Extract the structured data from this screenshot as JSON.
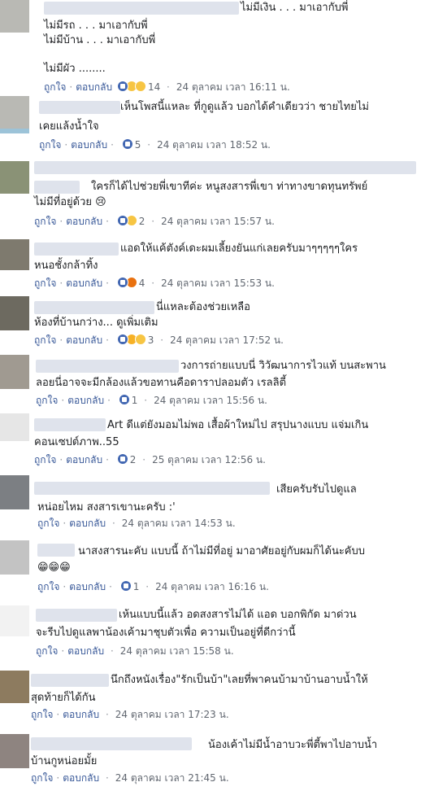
{
  "actions": {
    "like": "ถูกใจ",
    "reply": "ตอบกลับ",
    "dot": "·"
  },
  "comments": [
    {
      "lines": [
        "ไม่มีเงิน . . . มาเอากับพี่",
        "ไม่มีรถ . . . มาเอากับพี่",
        "ไม่มีบ้าน . . . มาเอากับพี่",
        "ไม่มีผัว ........"
      ],
      "reactions": [
        "like-icon",
        "haha-icon",
        "haha-icon"
      ],
      "count": "14",
      "time": "24 ตุลาคม เวลา 16:11 น."
    },
    {
      "lines": [
        "เห็นโพสนี้แหละ ที่กูดูแล้ว บอกได้คำเดียวว่า ชายไทยไม่",
        "เคยแล้งน้ำใจ"
      ],
      "reactions": [
        "like-icon"
      ],
      "count": "5",
      "time": "24 ตุลาคม เวลา 18:52 น."
    },
    {
      "lines": [
        "ใครก็ได้ไปช่วยพี่เขาทีค่ะ หนูสงสารพี่เขา ท่าทางขาดทุนทรัพย์",
        "ไม่มีที่อยู่ด้วย 😢"
      ],
      "reactions": [
        "like-icon",
        "haha-icon"
      ],
      "count": "2",
      "time": "24 ตุลาคม เวลา 15:57 น."
    },
    {
      "lines": [
        "แอดให้แค้ตังค์เดะผมเลี้ยงยันแก่เลยครับมาๆๆๆๆๆใคร",
        "หนอชั้งกล้าทิ้ง"
      ],
      "reactions": [
        "like-icon",
        "angry-icon"
      ],
      "count": "4",
      "time": "24 ตุลาคม เวลา 15:53 น."
    },
    {
      "lines": [
        "นี่แหละต้องช่วยเหลือ",
        "ห้องที่บ้านกว่าง... ดูเพิ่มเติม"
      ],
      "reactions": [
        "like-icon",
        "wow-icon",
        "haha-icon"
      ],
      "count": "3",
      "time": "24 ตุลาคม เวลา 17:52 น."
    },
    {
      "lines": [
        "วงการถ่ายแบบนี่ วิวัฒนาการไวแท้ บนสะพาน",
        "ลอยนี่อาจจะมีกล้องแล้วขอทานคือดาราปลอมตัว เรลลิตี้"
      ],
      "reactions": [
        "like-icon"
      ],
      "count": "1",
      "time": "24 ตุลาคม เวลา 15:56 น."
    },
    {
      "lines": [
        "Art ดีแต่ยังมอมไม่พอ เสื้อผ้าใหม่ไป สรุปนางแบบ แจ่มเกิน",
        "คอนเซปต์ภาพ..55"
      ],
      "reactions": [
        "like-icon"
      ],
      "count": "2",
      "time": "25 ตุลาคม เวลา 12:56 น."
    },
    {
      "lines": [
        "เสียครับรับไปดูแล",
        "หน่อยไหม สงสารเขานะครับ :'"
      ],
      "reactions": [],
      "count": "",
      "time": "24 ตุลาคม เวลา 14:53 น."
    },
    {
      "lines": [
        "นาสงสารนะคับ แบบนี้ ถ้าไม่มีที่อยู่ มาอาศัยอยู่กับผมก็ได้นะคับบ",
        "😁😁😁"
      ],
      "reactions": [
        "like-icon"
      ],
      "count": "1",
      "time": "24 ตุลาคม เวลา 16:16 น."
    },
    {
      "lines": [
        "เห้นแบบนี้แล้ว อดสงสารไม่ได้ แอด บอกพิกัด มาด่วน",
        "จะรีบไปดูแลพาน้องเค้ามาชุบตัวเพื่อ ความเป็นอยู่ที่ดีกว่านี้"
      ],
      "reactions": [],
      "count": "",
      "time": "24 ตุลาคม เวลา 15:58 น."
    },
    {
      "lines": [
        "นึกถึงหนังเรื่อง\"รักเป็นบ้า\"เลยที่พาคนบ้ามาบ้านอาบน้ำให้",
        "สุดท้ายก็ได้กัน"
      ],
      "reactions": [],
      "count": "",
      "time": "24 ตุลาคม เวลา 17:23 น."
    },
    {
      "lines": [
        "น้องเค้าไม่มีน้ำอาบวะพี่ตี้พาไปอาบน้ำ",
        "บ้านกูหน่อยมั้ย"
      ],
      "reactions": [],
      "count": "",
      "time": "24 ตุลาคม เวลา 21:45 น."
    }
  ]
}
